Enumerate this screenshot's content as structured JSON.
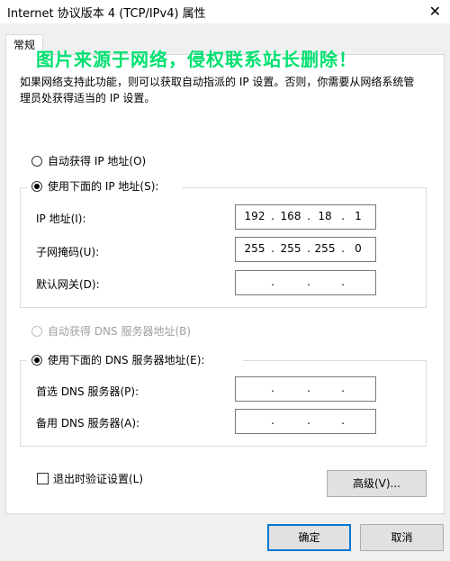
{
  "window": {
    "title": "Internet 协议版本 4 (TCP/IPv4) 属性"
  },
  "tab": {
    "label": "常规"
  },
  "watermark": "图片来源于网络，侵权联系站长删除！",
  "description": "如果网络支持此功能，则可以获取自动指派的 IP 设置。否则，你需要从网络系统管理员处获得适当的 IP 设置。",
  "ip": {
    "auto_label": "自动获得 IP 地址(O)",
    "manual_label": "使用下面的 IP 地址(S):",
    "selected": "manual",
    "address_label": "IP 地址(I):",
    "address": [
      "192",
      "168",
      "18",
      "1"
    ],
    "mask_label": "子网掩码(U):",
    "mask": [
      "255",
      "255",
      "255",
      "0"
    ],
    "gateway_label": "默认网关(D):",
    "gateway": [
      "",
      "",
      "",
      ""
    ]
  },
  "dns": {
    "auto_label": "自动获得 DNS 服务器地址(B)",
    "manual_label": "使用下面的 DNS 服务器地址(E):",
    "selected": "manual",
    "preferred_label": "首选 DNS 服务器(P):",
    "preferred": [
      "",
      "",
      "",
      ""
    ],
    "alternate_label": "备用 DNS 服务器(A):",
    "alternate": [
      "",
      "",
      "",
      ""
    ]
  },
  "validate_label": "退出时验证设置(L)",
  "validate_checked": false,
  "buttons": {
    "advanced": "高级(V)...",
    "ok": "确定",
    "cancel": "取消"
  },
  "icons": {
    "close": "close-icon"
  }
}
